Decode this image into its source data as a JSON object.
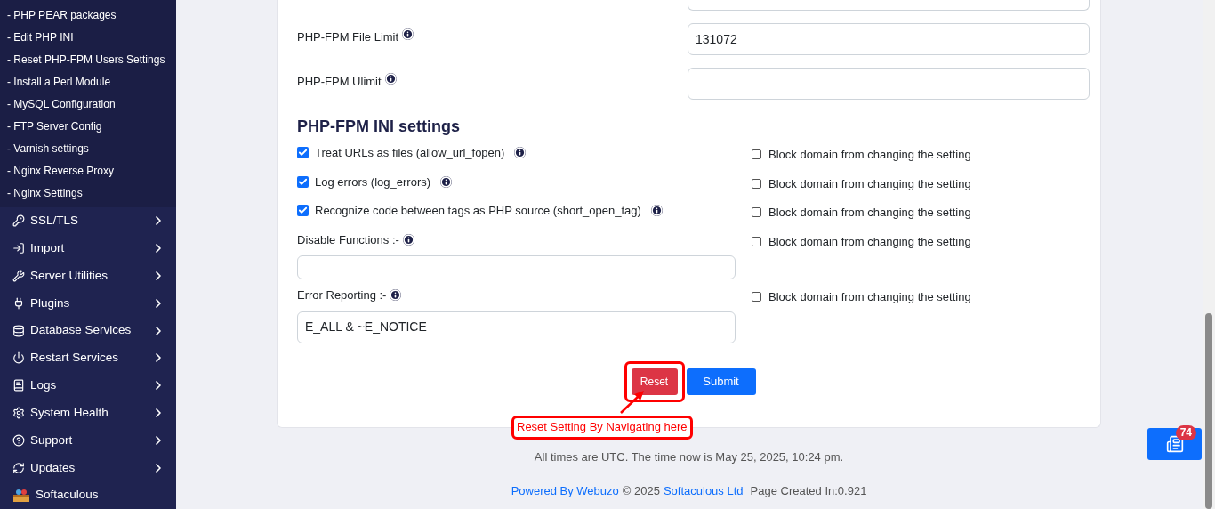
{
  "sidebar": {
    "submenu": [
      "- PHP PEAR packages",
      "- Edit PHP INI",
      "- Reset PHP-FPM Users Settings",
      "- Install a Perl Module",
      "- MySQL Configuration",
      "- FTP Server Config",
      "- Varnish settings",
      "- Nginx Reverse Proxy",
      "- Nginx Settings"
    ],
    "items": [
      {
        "label": "SSL/TLS",
        "expandable": true
      },
      {
        "label": "Import",
        "expandable": true
      },
      {
        "label": "Server Utilities",
        "expandable": true
      },
      {
        "label": "Plugins",
        "expandable": true
      },
      {
        "label": "Database Services",
        "expandable": true
      },
      {
        "label": "Restart Services",
        "expandable": true
      },
      {
        "label": "Logs",
        "expandable": true
      },
      {
        "label": "System Health",
        "expandable": true
      },
      {
        "label": "Support",
        "expandable": true
      },
      {
        "label": "Updates",
        "expandable": true
      },
      {
        "label": "Softaculous",
        "expandable": false
      }
    ]
  },
  "fields": [
    {
      "label": "PHP-FPM File Limit",
      "value": "131072"
    },
    {
      "label": "PHP-FPM Ulimit"
    }
  ],
  "ini": {
    "heading": "PHP-FPM INI settings",
    "settings": [
      {
        "kind": "checkbox",
        "label": "Treat URLs as files (allow_url_fopen)",
        "checked": true,
        "block_label": "Block domain from changing the setting",
        "block_checked": false
      },
      {
        "kind": "checkbox",
        "label": "Log errors (log_errors)",
        "checked": true,
        "block_label": "Block domain from changing the setting",
        "block_checked": false
      },
      {
        "kind": "checkbox",
        "label": "Recognize code between tags as PHP source (short_open_tag)",
        "checked": true,
        "block_label": "Block domain from changing the setting",
        "block_checked": false
      },
      {
        "kind": "text",
        "label": "Disable Functions :-",
        "block_label": "Block domain from changing the setting",
        "block_checked": false
      },
      {
        "kind": "text",
        "label": "Error Reporting :-",
        "value": "E_ALL & ~E_NOTICE",
        "block_label": "Block domain from changing the setting",
        "block_checked": false
      }
    ]
  },
  "buttons": {
    "reset": "Reset",
    "submit": "Submit"
  },
  "annotation": "Reset Setting By Navigating here",
  "footer": {
    "time": "All times are UTC. The time now is May 25, 2025, 10:24 pm.",
    "powered": "Powered By Webuzo",
    "copyright": "© 2025",
    "company": "Softaculous Ltd",
    "created": "Page Created In:0.921"
  },
  "notifications": {
    "count": "74"
  }
}
